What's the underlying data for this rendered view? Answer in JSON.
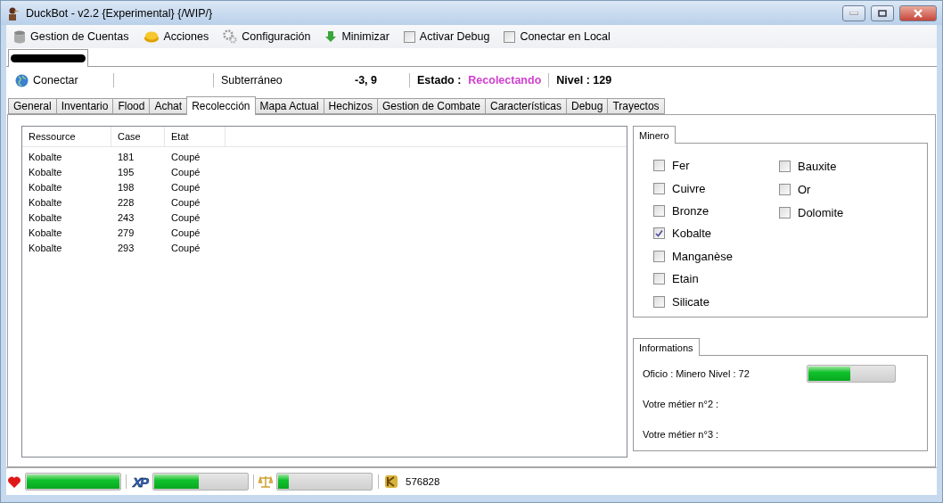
{
  "window": {
    "title": "DuckBot - v2.2 {Experimental} {/WIP/}"
  },
  "menu": [
    {
      "kind": "item",
      "label": "Gestion de Cuentas"
    },
    {
      "kind": "item",
      "label": "Acciones"
    },
    {
      "kind": "item",
      "label": "Configuración"
    },
    {
      "kind": "item",
      "label": "Minimizar"
    },
    {
      "kind": "check",
      "label": "Activar Debug",
      "checked": false
    },
    {
      "kind": "check",
      "label": "Conectar en Local",
      "checked": false
    }
  ],
  "account_tabs": [
    {
      "kind": "redacted",
      "selected": true
    }
  ],
  "info_row": {
    "connect": "Conectar",
    "map": "Subterráneo",
    "coords": "-3, 9",
    "state_label": "Estado :",
    "state": "Recolectando",
    "level": "Nivel : 129"
  },
  "tabs": [
    {
      "label": "General",
      "selected": false
    },
    {
      "label": "Inventario",
      "selected": false
    },
    {
      "label": "Flood",
      "selected": false
    },
    {
      "label": "Achat",
      "selected": false
    },
    {
      "label": "Recolección",
      "selected": true
    },
    {
      "label": "Mapa Actual",
      "selected": false
    },
    {
      "label": "Hechizos",
      "selected": false
    },
    {
      "label": "Gestion de Combate",
      "selected": false
    },
    {
      "label": "Características",
      "selected": false
    },
    {
      "label": "Debug",
      "selected": false
    },
    {
      "label": "Trayectos",
      "selected": false
    }
  ],
  "table": {
    "columns": [
      "Ressource",
      "Case",
      "Etat"
    ],
    "rows": [
      [
        "Kobalte",
        "181",
        "Coupé"
      ],
      [
        "Kobalte",
        "195",
        "Coupé"
      ],
      [
        "Kobalte",
        "198",
        "Coupé"
      ],
      [
        "Kobalte",
        "228",
        "Coupé"
      ],
      [
        "Kobalte",
        "243",
        "Coupé"
      ],
      [
        "Kobalte",
        "279",
        "Coupé"
      ],
      [
        "Kobalte",
        "293",
        "Coupé"
      ]
    ]
  },
  "minero": {
    "tab": "Minero",
    "columns": [
      [
        {
          "label": "Fer",
          "checked": false
        },
        {
          "label": "Cuivre",
          "checked": false
        },
        {
          "label": "Bronze",
          "checked": false
        },
        {
          "label": "Kobalte",
          "checked": true
        },
        {
          "label": "Manganèse",
          "checked": false
        },
        {
          "label": "Etain",
          "checked": false
        },
        {
          "label": "Silicate",
          "checked": false
        }
      ],
      [
        {
          "label": "Bauxite",
          "checked": false
        },
        {
          "label": "Or",
          "checked": false
        },
        {
          "label": "Dolomite",
          "checked": false
        }
      ]
    ]
  },
  "informations": {
    "tab": "Informations",
    "jobs": [
      {
        "label": "Oficio : Minero Nivel : 72",
        "level": 0.49
      },
      {
        "label": "Votre métier n°2 :"
      },
      {
        "label": "Votre métier n°3 :"
      }
    ]
  },
  "status_bar": {
    "life": {
      "level": 1.0
    },
    "xp": {
      "badge": "XP",
      "level": 0.48
    },
    "pods": {
      "level": 0.12
    },
    "kamas": "576828"
  }
}
